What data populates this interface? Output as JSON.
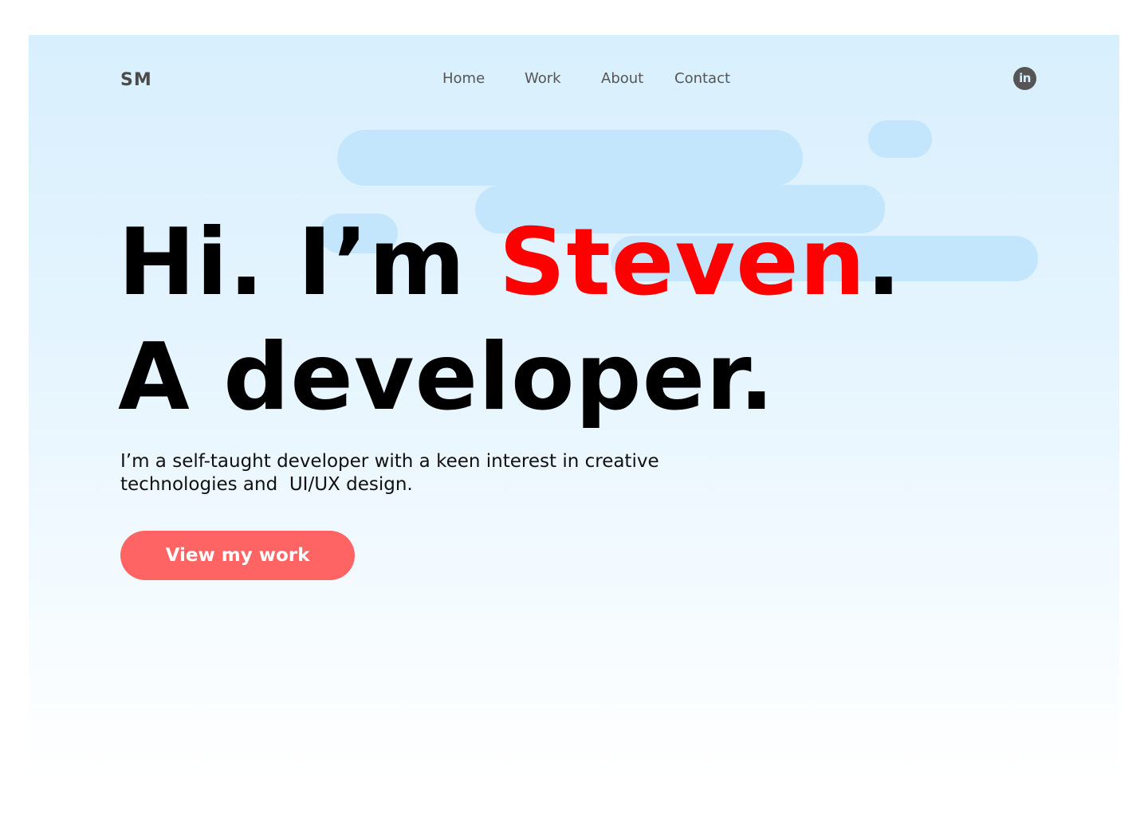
{
  "header": {
    "logo": "SM",
    "nav": [
      {
        "label": "Home"
      },
      {
        "label": "Work"
      },
      {
        "label": "About"
      },
      {
        "label": "Contact"
      }
    ],
    "social": {
      "icon": "linkedin-icon",
      "glyph": "in"
    }
  },
  "hero": {
    "line1_prefix": "Hi. I’m ",
    "line1_name": "Steven",
    "line1_suffix": ".",
    "line2": "A developer.",
    "intro_line1": "I’m a self-taught developer with a keen interest in creative",
    "intro_line2": "technologies and  UI/UX design.",
    "cta_label": "View my work"
  },
  "colors": {
    "accent": "#ff0000",
    "button": "#ff6464",
    "background_top": "#d8effd",
    "cloud": "#c3e6fc",
    "nav_text": "#555555"
  }
}
